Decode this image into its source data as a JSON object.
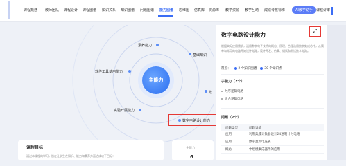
{
  "nav": {
    "items": [
      "课程概述",
      "教师团队",
      "课程设计",
      "课程图谱",
      "知识关系",
      "知识图谱",
      "问题图谱",
      "能力图谱",
      "思维图",
      "仿真库",
      "资源库",
      "教学资源",
      "教学互动",
      "成绩考核标准",
      "AI教学助手",
      "课程评审"
    ]
  },
  "graph": {
    "center_label": "主能力",
    "nodes": [
      "素养能力",
      "基础知识",
      "软件工具使用能力",
      "数",
      "实验开展能力",
      "数字电路设计能力"
    ]
  },
  "goal": {
    "title": "课程目标",
    "text": "通过本课程的学习，旨在让学生在知识、能力和素养方面达成以下目标："
  },
  "stat": {
    "label": "主能力",
    "value": "6"
  },
  "detail": {
    "title": "数字电路设计能力",
    "expand_icon": "expand-icon",
    "description": "根据实际应用需求，运用数字电子技术的概念、原理，合理选用数字集成芯片，从简单和常用的电路开始设计电路，设计开发、仿真、调试和测试数字电路。",
    "meta_label": "覆盖：",
    "meta_knowledge": "2 个知识图谱",
    "meta_points": "30 个知识点",
    "sub_title": "子能力（2个）",
    "sub_items": [
      "时序逻辑电路",
      "组合逻辑电路"
    ],
    "question_title": "问题（7个）",
    "table_headers": [
      "问题类型",
      "问题详情"
    ],
    "table_rows": [
      [
        "应用",
        "利用集成计数器设计24进制计时电路"
      ],
      [
        "应用",
        "数字直流电压表"
      ],
      [
        "概念",
        "中规模集成器件的应用"
      ]
    ]
  }
}
